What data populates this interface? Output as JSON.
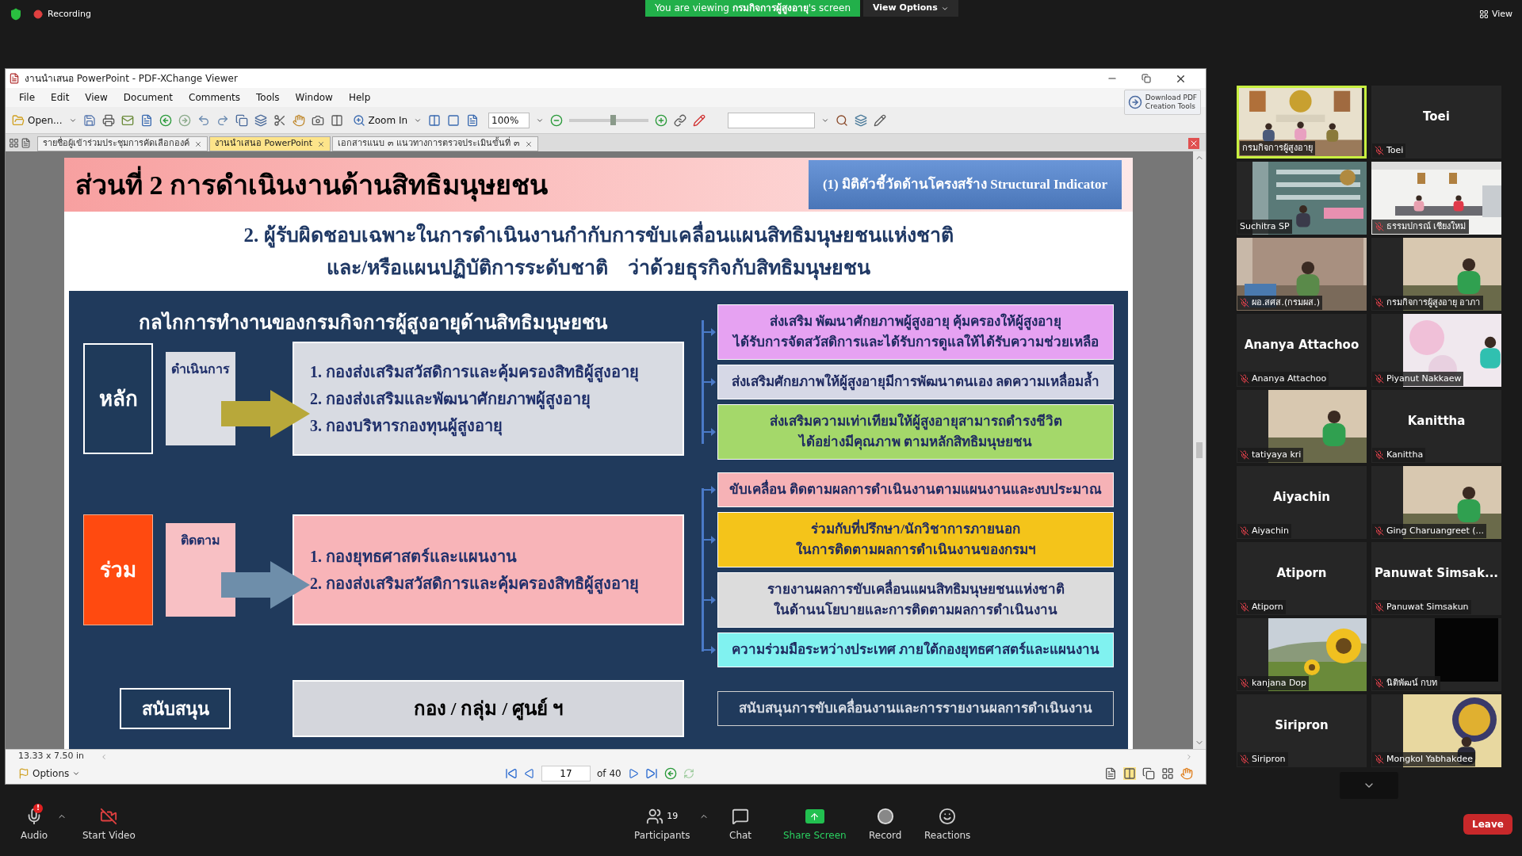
{
  "top_bar": {
    "recording": "Recording",
    "banner": "You are viewing **กรมกิจการผู้สูงอายุ**'s screen",
    "view_options": "View Options",
    "view": "View"
  },
  "viewer": {
    "title": "งานนำเสนอ PowerPoint - PDF-XChange Viewer",
    "menu": [
      "File",
      "Edit",
      "View",
      "Document",
      "Comments",
      "Tools",
      "Window",
      "Help"
    ],
    "download": [
      "Download PDF",
      "Creation Tools"
    ],
    "toolbar": {
      "open": "Open...",
      "zoom_in": "Zoom In",
      "zoom": "100%",
      "zoom_slider": {
        "level": 0.55
      }
    },
    "tabs": [
      {
        "label": "รายชื่อผู้เข้าร่วมประชุมการคัดเลือกองค์",
        "selected": false
      },
      {
        "label": "งานนำเสนอ PowerPoint",
        "selected": true
      },
      {
        "label": "เอกสารแนบ ๓ แนวทางการตรวจประเมินขั้นที่ ๓",
        "selected": false
      }
    ],
    "size": "13.33 x 7.50 in",
    "options": "Options",
    "page": "17",
    "page_count": "of 40"
  },
  "slide": {
    "title": "ส่วนที่ 2 การดำเนินงานด้านสิทธิมนุษยชน",
    "tag": "(1) มิติตัวชี้วัดด้านโครงสร้าง Structural Indicator",
    "subtitle": [
      "2. ผู้รับผิดชอบเฉพาะในการดำเนินงานกำกับการขับเคลื่อนแผนสิทธิมนุษยชนแห่งชาติ",
      "และ/หรือแผนปฏิบัติการระดับชาติ    ว่าด้วยธุรกิจกับสิทธิมนุษยชน"
    ],
    "heading": "กลไกการทำงานของกรมกิจการผู้สูงอายุด้านสิทธิมนุษยชน",
    "groups": [
      {
        "role": {
          "label": "หลัก",
          "kind": "outlined"
        },
        "action": {
          "label": "ดำเนินการ",
          "color": "#dcdee4"
        },
        "arrow": {
          "color": "#b8a83a"
        },
        "units": {
          "color": "#d8dbe2",
          "items": [
            "1. กองส่งเสริมสวัสดิการและคุ้มครองสิทธิผู้สูงอายุ",
            "2. กองส่งเสริมและพัฒนาศักยภาพผู้สูงอายุ",
            "3. กองบริหารกองทุนผู้สูงอายุ"
          ]
        },
        "outcomes": [
          {
            "lines": [
              "ส่งเสริม พัฒนาศักยภาพผู้สูงอายุ คุ้มครองให้ผู้สูงอายุ",
              "ได้รับการจัดสวัสดิการและได้รับการดูแลให้ได้รับความช่วยเหลือ"
            ],
            "color": "#e6a2f2"
          },
          {
            "lines": [
              "ส่งเสริมศักยภาพให้ผู้สูงอายุมีการพัฒนาตนเอง ลดความเหลื่อมล้ำ"
            ],
            "color": "#d6d8e6"
          },
          {
            "lines": [
              "ส่งเสริมความเท่าเทียมให้ผู้สูงอายุสามารถดำรงชีวิต",
              "ได้อย่างมีคุณภาพ ตามหลักสิทธิมนุษยชน"
            ],
            "color": "#a4d86a"
          }
        ]
      },
      {
        "role": {
          "label": "ร่วม",
          "kind": "filled"
        },
        "action": {
          "label": "ติดตาม",
          "color": "#f8c0c4"
        },
        "arrow": {
          "color": "#6e8eaa"
        },
        "units": {
          "color": "#f8b4b8",
          "items": [
            "1. กองยุทธศาสตร์และแผนงาน",
            "2. กองส่งเสริมสวัสดิการและคุ้มครองสิทธิผู้สูงอายุ"
          ]
        },
        "outcomes": [
          {
            "lines": [
              "ขับเคลื่อน ติดตามผลการดำเนินงานตามแผนงานและงบประมาณ"
            ],
            "color": "#f6b2b6"
          },
          {
            "lines": [
              "ร่วมกับที่ปรึกษา/นักวิชาการภายนอก",
              "ในการติดตามผลการดำเนินงานของกรมฯ"
            ],
            "color": "#f4c41a"
          },
          {
            "lines": [
              "รายงานผลการขับเคลื่อนแผนสิทธิมนุษยชนแห่งชาติ",
              "ในด้านนโยบายและการติดตามผลการดำเนินงาน"
            ],
            "color": "#dcdcdc"
          },
          {
            "lines": [
              "ความร่วมมือระหว่างประเทศ ภายใต้กองยุทธศาสตร์และแผนงาน"
            ],
            "color": "#80f2f0"
          }
        ]
      },
      {
        "role": {
          "label": "สนับสนุน",
          "kind": "outlined"
        },
        "units": {
          "color": "#d4d6dc",
          "items": [
            "กอง / กลุ่ม / ศูนย์ ฯ"
          ]
        },
        "outcomes": [
          {
            "lines": [
              "สนับสนุนการขับเคลื่อนงานและการรายงานผลการดำเนินงาน"
            ]
          }
        ]
      }
    ]
  },
  "participants": [
    {
      "kind": "video",
      "name": "กรมกิจการผู้สูงอายุ",
      "muted": false,
      "speaking": true
    },
    {
      "kind": "name",
      "display": "Toei",
      "name": "Toei",
      "muted": true,
      "speaking": false
    },
    {
      "kind": "video",
      "name": "Suchitra SP",
      "muted": false,
      "speaking": false
    },
    {
      "kind": "video",
      "name": "ธรรมปกรณ์ เชียงใหม่",
      "muted": true,
      "speaking": false
    },
    {
      "kind": "video",
      "name": "ผอ.สศส.(กรมผส.)",
      "muted": true,
      "speaking": false
    },
    {
      "kind": "video",
      "name": "กรมกิจการผู้สูงอายุ อาภา",
      "muted": true,
      "speaking": false
    },
    {
      "kind": "name",
      "display": "Ananya Attachoo",
      "name": "Ananya Attachoo",
      "muted": true,
      "speaking": false
    },
    {
      "kind": "video",
      "name": "Piyanut Nakkaew",
      "muted": true,
      "speaking": false
    },
    {
      "kind": "video",
      "name": "tatiyaya kri",
      "muted": true,
      "speaking": false
    },
    {
      "kind": "name",
      "display": "Kanittha",
      "name": "Kanittha",
      "muted": true,
      "speaking": false
    },
    {
      "kind": "name",
      "display": "Aiyachin",
      "name": "Aiyachin",
      "muted": true,
      "speaking": false
    },
    {
      "kind": "video",
      "name": "Ging Charuangreet (...",
      "muted": true,
      "speaking": false
    },
    {
      "kind": "name",
      "display": "Atiporn",
      "name": "Atiporn",
      "muted": true,
      "speaking": false
    },
    {
      "kind": "name",
      "display": "Panuwat  Simsak...",
      "name": "Panuwat Simsakun",
      "muted": true,
      "speaking": false
    },
    {
      "kind": "video",
      "name": "kanjana Dop",
      "muted": true,
      "speaking": false
    },
    {
      "kind": "video",
      "name": "นิติพัฒน์ กบท",
      "muted": true,
      "speaking": false
    },
    {
      "kind": "name",
      "display": "Siripron",
      "name": "Siripron",
      "muted": true,
      "speaking": false
    },
    {
      "kind": "video",
      "name": "Mongkol Yabhakdee",
      "muted": true,
      "speaking": false
    }
  ],
  "bottom_bar": [
    {
      "kind": "audio",
      "label": "Audio",
      "badge": "!"
    },
    {
      "kind": "video",
      "label": "Start Video"
    },
    {
      "kind": "participants",
      "label": "Participants",
      "count": "19"
    },
    {
      "kind": "chat",
      "label": "Chat"
    },
    {
      "kind": "share",
      "label": "Share Screen"
    },
    {
      "kind": "record",
      "label": "Record"
    },
    {
      "kind": "reactions",
      "label": "Reactions"
    }
  ],
  "leave": "Leave"
}
